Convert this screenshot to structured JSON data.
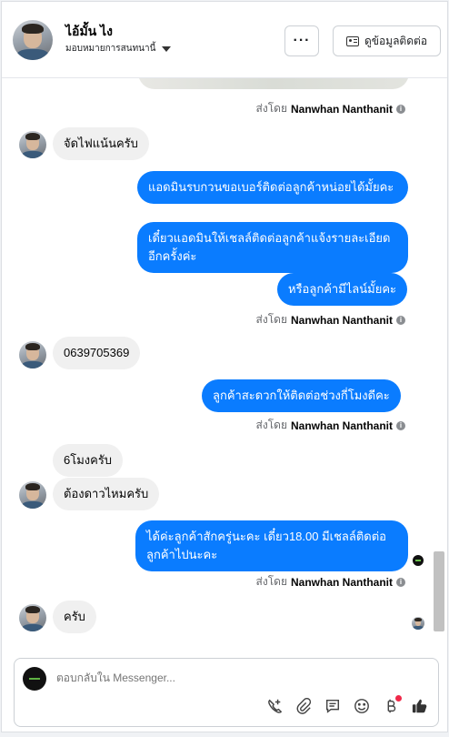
{
  "header": {
    "name": "ไอ้มั้น ไง",
    "subtitle": "มอบหมายการสนทนานี้",
    "more_label": "···",
    "contact_label": "ดูข้อมูลติดต่อ"
  },
  "sent_by": {
    "prefix": "ส่งโดย",
    "agent": "Nanwhan Nanthanit"
  },
  "messages": [
    {
      "dir": "in",
      "text": "จัดไฟแน้นครับ"
    },
    {
      "dir": "out",
      "text": "แอดมินรบกวนขอเบอร์ติดต่อลูกค้าหน่อยได้มั้ยคะ"
    },
    {
      "dir": "out",
      "text": "เดี๋ยวแอดมินให้เชลล์ติดต่อลูกค้าแจ้งรายละเอียดอีกครั้งค่ะ"
    },
    {
      "dir": "out",
      "text": "หรือลูกค้ามีไลน์มั้ยคะ"
    },
    {
      "dir": "in",
      "text": "0639705369"
    },
    {
      "dir": "out",
      "text": "ลูกค้าสะดวกให้ติดต่อช่วงกี่โมงดีคะ"
    },
    {
      "dir": "in",
      "text": "6โมงครับ"
    },
    {
      "dir": "in",
      "text": "ต้องดาวไหมครับ"
    },
    {
      "dir": "out",
      "text": "ได้ค่ะลูกค้าสักครู่นะคะ เดี๋ยว18.00 มีเชลล์ติดต่อลูกค้าไปนะคะ"
    },
    {
      "dir": "in",
      "text": "ครับ"
    }
  ],
  "composer": {
    "placeholder": "ตอบกลับใน Messenger..."
  },
  "icons": [
    "more-icon",
    "contact-card-icon",
    "info-icon",
    "phone-add-icon",
    "attachment-icon",
    "saved-reply-icon",
    "emoji-icon",
    "baht-icon",
    "like-icon",
    "caret-down-icon"
  ],
  "colors": {
    "outgoing_bubble": "#0a7cff",
    "incoming_bubble": "#f0f0f0",
    "notification_dot": "#f02849"
  }
}
